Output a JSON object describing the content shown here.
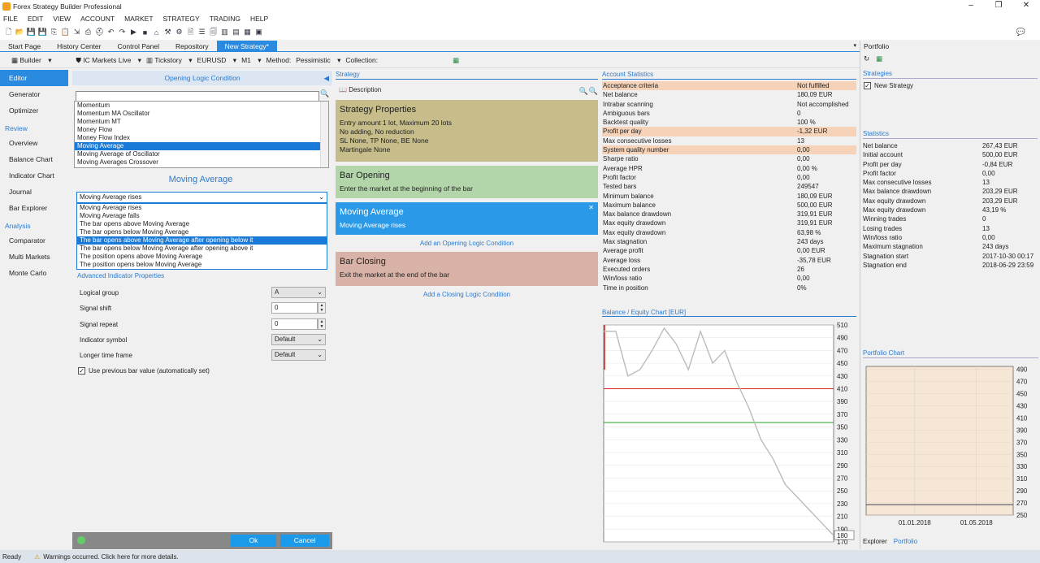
{
  "app": {
    "title": "Forex Strategy Builder Professional"
  },
  "menu": [
    "FILE",
    "EDIT",
    "VIEW",
    "ACCOUNT",
    "MARKET",
    "STRATEGY",
    "TRADING",
    "HELP"
  ],
  "tabs": [
    {
      "label": "Start Page"
    },
    {
      "label": "History Center"
    },
    {
      "label": "Control Panel"
    },
    {
      "label": "Repository"
    },
    {
      "label": "New Strategy*",
      "active": true
    }
  ],
  "toolbar2": {
    "builder": "Builder",
    "broker": "IC Markets Live",
    "datafeed": "Tickstory",
    "symbol": "EURUSD",
    "period": "M1",
    "method_label": "Method:",
    "method": "Pessimistic",
    "collection_label": "Collection:"
  },
  "nav": {
    "items": [
      {
        "label": "Editor",
        "active": true
      },
      {
        "label": "Generator"
      },
      {
        "label": "Optimizer"
      }
    ],
    "review_label": "Review",
    "review": [
      "Overview",
      "Balance Chart",
      "Indicator Chart",
      "Journal",
      "Bar Explorer"
    ],
    "analysis_label": "Analysis",
    "analysis": [
      "Comparator",
      "Multi Markets",
      "Monte Carlo"
    ]
  },
  "editor": {
    "header": "Opening Logic Condition",
    "indicators": [
      "Momentum",
      "Momentum MA Oscillator",
      "Momentum MT",
      "Money Flow",
      "Money Flow Index",
      "Moving Average",
      "Moving Average of Oscillator",
      "Moving Averages Crossover"
    ],
    "selected_indicator": "Moving Average",
    "indicator_title": "Moving Average",
    "logic_selected": "Moving Average rises",
    "logic_options": [
      "Moving Average rises",
      "Moving Average falls",
      "The bar opens above Moving Average",
      "The bar opens below Moving Average",
      "The bar opens above Moving Average after opening below it",
      "The bar opens below Moving Average after opening above it",
      "The position opens above Moving Average",
      "The position opens below Moving Average"
    ],
    "advanced_label": "Advanced Indicator Properties",
    "params": [
      {
        "label": "Logical group",
        "value": "A",
        "type": "select"
      },
      {
        "label": "Signal shift",
        "value": "0",
        "type": "num"
      },
      {
        "label": "Signal repeat",
        "value": "0",
        "type": "num"
      },
      {
        "label": "Indicator symbol",
        "value": "Default",
        "type": "select"
      },
      {
        "label": "Longer time frame",
        "value": "Default",
        "type": "select"
      }
    ],
    "use_prev_bar": "Use previous bar value (automatically set)",
    "ok": "Ok",
    "cancel": "Cancel"
  },
  "strategy": {
    "label": "Strategy",
    "description": "Description",
    "props_title": "Strategy Properties",
    "props_lines": [
      "Entry amount 1 lot, Maximum 20 lots",
      "No adding, No reduction",
      "SL None,  TP None,  BE None",
      "Martingale None"
    ],
    "opening_title": "Bar Opening",
    "opening_line": "Enter the market at the beginning of the bar",
    "ma_title": "Moving Average",
    "ma_line": "Moving Average rises",
    "add_opening": "Add an Opening Logic Condition",
    "closing_title": "Bar Closing",
    "closing_line": "Exit the market at the end of the bar",
    "add_closing": "Add a Closing Logic Condition"
  },
  "account": {
    "label": "Account Statistics",
    "rows": [
      [
        "Acceptance criteria",
        "Not fulfilled",
        true
      ],
      [
        "Net balance",
        "180,09 EUR",
        false
      ],
      [
        "Intrabar scanning",
        "Not accomplished",
        false
      ],
      [
        "Ambiguous bars",
        "0",
        false
      ],
      [
        "Backtest quality",
        "100 %",
        false
      ],
      [
        "Profit per day",
        "-1,32 EUR",
        true
      ],
      [
        "Max consecutive losses",
        "13",
        false
      ],
      [
        "System quality number",
        "0,00",
        true
      ],
      [
        "Sharpe ratio",
        "0,00",
        false
      ],
      [
        "Average HPR",
        "0,00 %",
        false
      ],
      [
        "Profit factor",
        "0,00",
        false
      ],
      [
        "Tested bars",
        "249547",
        false
      ],
      [
        "Minimum balance",
        "180,09 EUR",
        false
      ],
      [
        "Maximum balance",
        "500,00 EUR",
        false
      ],
      [
        "Max balance drawdown",
        "319,91 EUR",
        false
      ],
      [
        "Max equity drawdown",
        "319,91 EUR",
        false
      ],
      [
        "Max equity drawdown",
        "63,98 %",
        false
      ],
      [
        "Max stagnation",
        "243 days",
        false
      ],
      [
        "Average profit",
        "0,00 EUR",
        false
      ],
      [
        "Average loss",
        "-35,78 EUR",
        false
      ],
      [
        "Executed orders",
        "26",
        false
      ],
      [
        "Win/loss ratio",
        "0,00",
        false
      ],
      [
        "Time in position",
        "0%",
        false
      ]
    ]
  },
  "balance_chart": {
    "label": "Balance / Equity Chart [EUR]",
    "current": "180"
  },
  "chart_data": [
    {
      "type": "line",
      "title": "Balance / Equity Chart [EUR]",
      "yticks": [
        510,
        490,
        470,
        450,
        430,
        410,
        390,
        370,
        350,
        330,
        310,
        290,
        270,
        250,
        230,
        210,
        190,
        170
      ],
      "ylim": [
        170,
        510
      ],
      "series": [
        {
          "values": [
            500,
            500,
            430,
            440,
            470,
            505,
            480,
            440,
            500,
            450,
            470,
            420,
            380,
            330,
            300,
            260,
            240,
            220,
            200,
            180
          ]
        }
      ]
    },
    {
      "type": "line",
      "title": "Portfolio Chart",
      "yticks": [
        490,
        470,
        450,
        430,
        410,
        390,
        370,
        350,
        330,
        310,
        290,
        270,
        250
      ],
      "xticks": [
        "01.01.2018",
        "01.05.2018"
      ],
      "ylim": [
        250,
        495
      ],
      "series": [
        {
          "values": [
            267,
            267
          ]
        }
      ]
    }
  ],
  "portfolio": {
    "label": "Portfolio",
    "strategies_label": "Strategies",
    "strategy": "New Strategy",
    "statistics_label": "Statistics",
    "stats": [
      [
        "Net balance",
        "267,43 EUR"
      ],
      [
        "Initial account",
        "500,00 EUR"
      ],
      [
        "Profit per day",
        "-0,84 EUR"
      ],
      [
        "Profit factor",
        "0,00"
      ],
      [
        "Max consecutive losses",
        "13"
      ],
      [
        "Max balance drawdown",
        "203,29 EUR"
      ],
      [
        "Max equity drawdown",
        "203,29 EUR"
      ],
      [
        "Max equity drawdown",
        "43,19 %"
      ],
      [
        "Winning trades",
        "0"
      ],
      [
        "Losing trades",
        "13"
      ],
      [
        "Win/loss ratio",
        "0,00"
      ],
      [
        "Maximum stagnation",
        "243 days"
      ],
      [
        "Stagnation start",
        "2017-10-30 00:17"
      ],
      [
        "Stagnation end",
        "2018-06-29 23:59"
      ]
    ],
    "chart_label": "Portfolio Chart",
    "bottom_tabs": [
      "Explorer",
      "Portfolio"
    ]
  },
  "status": {
    "ready": "Ready",
    "warning": "Warnings occurred. Click here for more details."
  }
}
